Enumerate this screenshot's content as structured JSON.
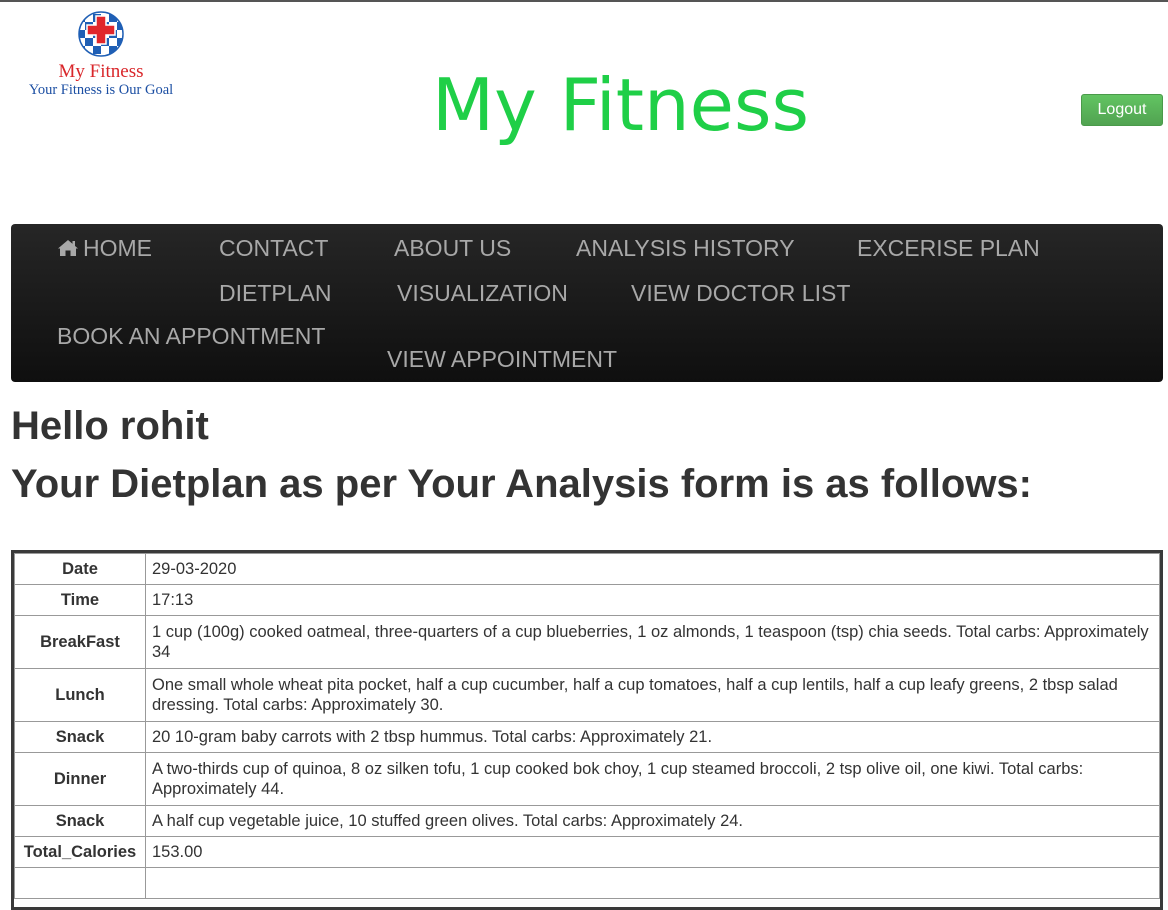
{
  "logo": {
    "name": "My Fitness",
    "tagline": "Your Fitness is Our Goal",
    "colors": {
      "red": "#d9262a",
      "blue": "#1c4fa3"
    }
  },
  "header": {
    "title": "My Fitness",
    "title_color": "#1fcf47",
    "logout_label": "Logout"
  },
  "nav": {
    "items": [
      {
        "label": "HOME",
        "icon": "home-icon"
      },
      {
        "label": "CONTACT"
      },
      {
        "label": "ABOUT US"
      },
      {
        "label": "ANALYSIS HISTORY"
      },
      {
        "label": "EXCERISE PLAN"
      },
      {
        "label": "DIETPLAN"
      },
      {
        "label": "VISUALIZATION"
      },
      {
        "label": "VIEW DOCTOR LIST"
      },
      {
        "label": "BOOK AN APPONTMENT"
      },
      {
        "label": "VIEW APPOINTMENT"
      }
    ]
  },
  "main": {
    "greeting": "Hello rohit",
    "subheading": "Your Dietplan as per Your Analysis form is as follows:"
  },
  "dietplan": {
    "rows": [
      {
        "label": "Date",
        "value": "29-03-2020"
      },
      {
        "label": "Time",
        "value": "17:13"
      },
      {
        "label": "BreakFast",
        "value": "1 cup (100g) cooked oatmeal, three-quarters of a cup blueberries, 1 oz almonds, 1 teaspoon (tsp) chia seeds. Total carbs: Approximately 34"
      },
      {
        "label": "Lunch",
        "value": "One small whole wheat pita pocket, half a cup cucumber, half a cup tomatoes, half a cup lentils, half a cup leafy greens, 2 tbsp salad dressing. Total carbs: Approximately 30."
      },
      {
        "label": "Snack",
        "value": "20 10-gram baby carrots with 2 tbsp hummus. Total carbs: Approximately 21."
      },
      {
        "label": "Dinner",
        "value": "A two-thirds cup of quinoa, 8 oz silken tofu, 1 cup cooked bok choy, 1 cup steamed broccoli, 2 tsp olive oil, one kiwi. Total carbs: Approximately 44."
      },
      {
        "label": "Snack",
        "value": "A half cup vegetable juice, 10 stuffed green olives. Total carbs: Approximately 24."
      },
      {
        "label": "Total_Calories",
        "value": "153.00"
      }
    ]
  }
}
